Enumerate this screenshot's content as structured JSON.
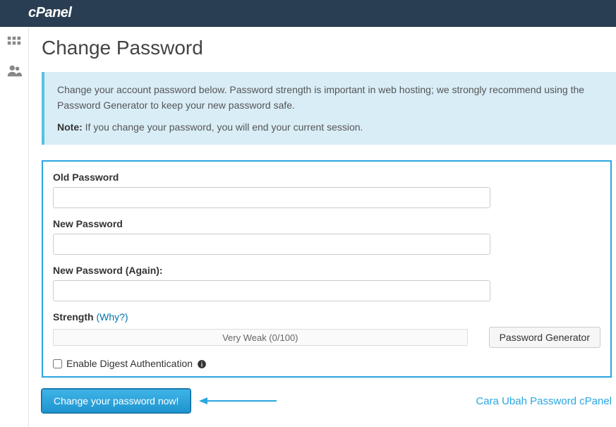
{
  "brand": "cPanel",
  "page": {
    "title": "Change Password"
  },
  "info": {
    "intro": "Change your account password below. Password strength is important in web hosting; we strongly recommend using the Password Generator to keep your new password safe.",
    "note_label": "Note:",
    "note_text": "If you change your password, you will end your current session."
  },
  "form": {
    "old_password": {
      "label": "Old Password",
      "value": ""
    },
    "new_password": {
      "label": "New Password",
      "value": ""
    },
    "new_password_again": {
      "label": "New Password (Again):",
      "value": ""
    },
    "strength": {
      "label": "Strength",
      "why": "(Why?)",
      "meter_text": "Very Weak (0/100)",
      "generator_label": "Password Generator"
    },
    "digest": {
      "label": "Enable Digest Authentication",
      "checked": false
    },
    "submit_label": "Change your password now!"
  },
  "caption": "Cara Ubah Password cPanel"
}
